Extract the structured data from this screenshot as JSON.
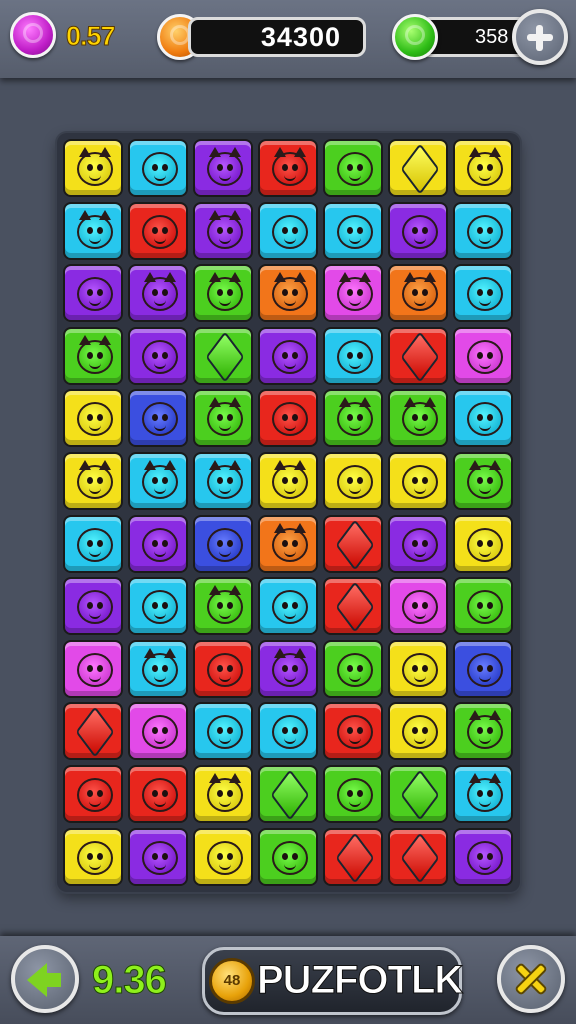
{
  "hud": {
    "gems_value": "0.57",
    "score": "34300",
    "lives_value": "358",
    "gem_icon": "purple-gem-orb-icon",
    "coin_icon": "orange-coin-orb-icon",
    "life_icon": "green-orb-icon",
    "plus_icon": "plus-icon"
  },
  "board": {
    "rows": 12,
    "cols": 7,
    "palette": {
      "Y": "#f4e01a",
      "C": "#27c7ee",
      "P": "#8a2be2",
      "R": "#e8261d",
      "G": "#4ccf1f",
      "O": "#f2751a",
      "M": "#e24ae8",
      "B": "#3b4fe0"
    },
    "tiles": [
      [
        [
          "Y",
          "cat"
        ],
        [
          "C",
          "face"
        ],
        [
          "P",
          "cat"
        ],
        [
          "R",
          "cat"
        ],
        [
          "G",
          "face"
        ],
        [
          "Y",
          "gem"
        ],
        [
          "Y",
          "cat"
        ]
      ],
      [
        [
          "C",
          "cat"
        ],
        [
          "R",
          "face"
        ],
        [
          "P",
          "cat"
        ],
        [
          "C",
          "face"
        ],
        [
          "C",
          "face"
        ],
        [
          "P",
          "face"
        ],
        [
          "C",
          "face"
        ]
      ],
      [
        [
          "P",
          "face"
        ],
        [
          "P",
          "cat"
        ],
        [
          "G",
          "cat"
        ],
        [
          "O",
          "cat"
        ],
        [
          "M",
          "cat"
        ],
        [
          "O",
          "cat"
        ],
        [
          "C",
          "face"
        ]
      ],
      [
        [
          "G",
          "cat"
        ],
        [
          "P",
          "face"
        ],
        [
          "G",
          "gem"
        ],
        [
          "P",
          "face"
        ],
        [
          "C",
          "face"
        ],
        [
          "R",
          "gem"
        ],
        [
          "M",
          "face"
        ]
      ],
      [
        [
          "Y",
          "face"
        ],
        [
          "B",
          "face"
        ],
        [
          "G",
          "cat"
        ],
        [
          "R",
          "face"
        ],
        [
          "G",
          "cat"
        ],
        [
          "G",
          "cat"
        ],
        [
          "C",
          "face"
        ]
      ],
      [
        [
          "Y",
          "cat"
        ],
        [
          "C",
          "cat"
        ],
        [
          "C",
          "cat"
        ],
        [
          "Y",
          "cat"
        ],
        [
          "Y",
          "face"
        ],
        [
          "Y",
          "face"
        ],
        [
          "G",
          "cat"
        ]
      ],
      [
        [
          "C",
          "face"
        ],
        [
          "P",
          "face"
        ],
        [
          "B",
          "face"
        ],
        [
          "O",
          "cat"
        ],
        [
          "R",
          "gem"
        ],
        [
          "P",
          "face"
        ],
        [
          "Y",
          "face"
        ]
      ],
      [
        [
          "P",
          "face"
        ],
        [
          "C",
          "face"
        ],
        [
          "G",
          "cat"
        ],
        [
          "C",
          "face"
        ],
        [
          "R",
          "gem"
        ],
        [
          "M",
          "face"
        ],
        [
          "G",
          "face"
        ]
      ],
      [
        [
          "M",
          "face"
        ],
        [
          "C",
          "cat"
        ],
        [
          "R",
          "face"
        ],
        [
          "P",
          "cat"
        ],
        [
          "G",
          "face"
        ],
        [
          "Y",
          "face"
        ],
        [
          "B",
          "face"
        ]
      ],
      [
        [
          "R",
          "gem"
        ],
        [
          "M",
          "face"
        ],
        [
          "C",
          "face"
        ],
        [
          "C",
          "face"
        ],
        [
          "R",
          "face"
        ],
        [
          "Y",
          "face"
        ],
        [
          "G",
          "cat"
        ]
      ],
      [
        [
          "R",
          "face"
        ],
        [
          "R",
          "face"
        ],
        [
          "Y",
          "cat"
        ],
        [
          "G",
          "gem"
        ],
        [
          "G",
          "face"
        ],
        [
          "G",
          "gem"
        ],
        [
          "C",
          "cat"
        ]
      ],
      [
        [
          "Y",
          "face"
        ],
        [
          "P",
          "face"
        ],
        [
          "Y",
          "face"
        ],
        [
          "G",
          "face"
        ],
        [
          "R",
          "gem"
        ],
        [
          "R",
          "gem"
        ],
        [
          "P",
          "face"
        ]
      ]
    ]
  },
  "bottom": {
    "back_icon": "back-arrow-icon",
    "timer": "9.36",
    "coin_badge": "48",
    "title": "PUZFOTLK",
    "close_icon": "close-x-icon"
  }
}
